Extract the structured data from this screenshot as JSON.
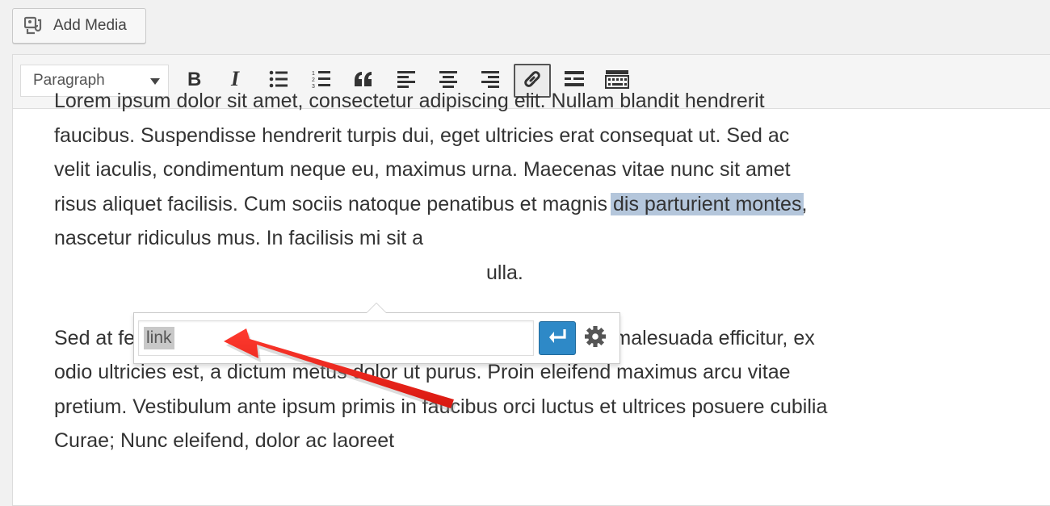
{
  "media": {
    "add_media_label": "Add Media"
  },
  "toolbar": {
    "format_selected": "Paragraph",
    "buttons": [
      "bold",
      "italic",
      "bulleted-list",
      "numbered-list",
      "blockquote",
      "align-left",
      "align-center",
      "align-right",
      "insert-link",
      "read-more",
      "toolbar-toggle"
    ]
  },
  "content": {
    "para1_before": "Lorem ipsum dolor sit amet, consectetur adipiscing elit. Nullam blandit hendrerit faucibus. Suspendisse hendrerit turpis dui, eget ultricies erat consequat ut. Sed ac velit iaculis, condimentum neque eu, maximus urna. Maecenas vitae nunc sit amet risus aliquet facilisis. Cum sociis natoque penatibus et magnis ",
    "para1_selected": "dis parturient montes",
    "para1_after": ", nascetur ridiculus mus. In facilisis mi sit a",
    "para1_tail": "ulla.",
    "para2": "Sed at fermentum lacus. Praesent consectetur, nisi consequat malesuada efficitur, ex odio ultricies est, a dictum metus dolor ut purus. Proin eleifend maximus arcu vitae pretium. Vestibulum ante ipsum primis in faucibus orci luctus et ultrices posuere cubilia Curae; Nunc eleifend, dolor ac laoreet"
  },
  "link_popup": {
    "url_value": "link",
    "apply_icon": "enter-arrow-icon",
    "settings_icon": "gear-icon"
  },
  "colors": {
    "apply_button": "#2e89c7",
    "selection": "#b4c6db",
    "annotation_arrow": "#e8221b"
  }
}
